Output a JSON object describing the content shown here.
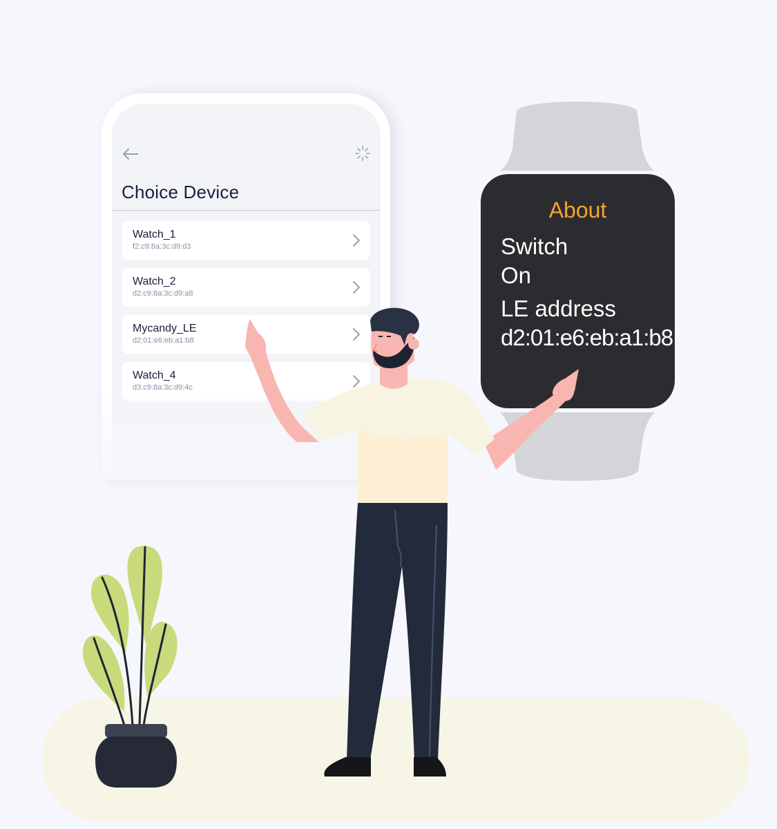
{
  "phone": {
    "back_icon": "arrow-left-icon",
    "loading_icon": "spinner-icon",
    "title": "Choice Device",
    "devices": [
      {
        "name": "Watch_1",
        "address": "f2:c9:8a:3c:d9:d3"
      },
      {
        "name": "Watch_2",
        "address": "d2:c9:8a:3c:d9:a8"
      },
      {
        "name": "Mycandy_LE",
        "address": "d2:01:e6:eb:a1:b8"
      },
      {
        "name": "Watch_4",
        "address": "d3:c9:8a:3c:d9:4c"
      }
    ]
  },
  "watch": {
    "heading": "About",
    "line1": "Switch",
    "line2": "On",
    "line3": "LE address",
    "line4": "d2:01:e6:eb:a1:b8"
  },
  "colors": {
    "background": "#f6f7fc",
    "accent_orange": "#f4a52c",
    "watch_face": "#2c2c30",
    "text_dark": "#1a1f3a"
  }
}
